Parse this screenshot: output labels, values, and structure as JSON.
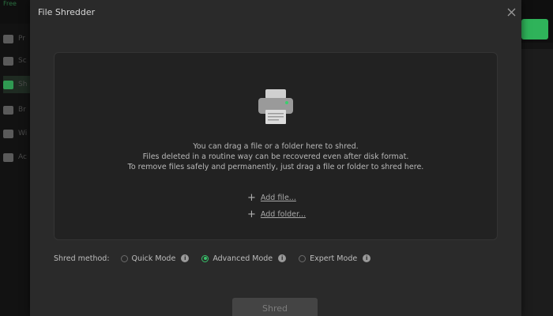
{
  "background_app": {
    "brand": "Free",
    "nav_items": [
      {
        "label": "Pr",
        "icon": "grid-icon"
      },
      {
        "label": "Sc",
        "icon": "scan-icon"
      },
      {
        "label": "Sh",
        "icon": "shredder-icon",
        "active": true
      },
      {
        "label": "Br",
        "icon": "browser-icon"
      },
      {
        "label": "Wi",
        "icon": "lock-icon"
      },
      {
        "label": "Ac",
        "icon": "account-icon"
      }
    ],
    "accent_color": "#2fb35a"
  },
  "dialog": {
    "title": "File Shredder",
    "close_icon": "close-icon",
    "drop_zone": {
      "icon": "shredder-icon",
      "lines": [
        "You can drag a file or a folder here to shred.",
        "Files deleted in a routine way can be recovered even after disk format.",
        "To remove files safely and permanently, just drag a file or folder to shred here."
      ],
      "add_file": "Add file...",
      "add_folder": "Add folder..."
    },
    "shred_method": {
      "label": "Shred method:",
      "options": [
        {
          "label": "Quick Mode",
          "selected": false
        },
        {
          "label": "Advanced Mode",
          "selected": true
        },
        {
          "label": "Expert Mode",
          "selected": false
        }
      ]
    },
    "shred_button": "Shred",
    "selected_color": "#37c26a"
  }
}
